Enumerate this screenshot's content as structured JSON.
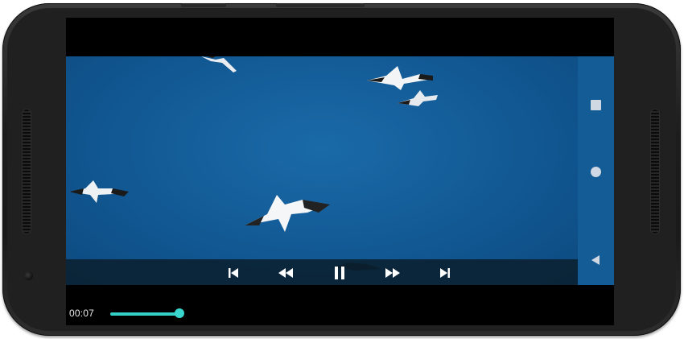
{
  "player": {
    "current_time": "00:07",
    "progress_percent": 21
  },
  "controls": {
    "skip_previous_icon": "skip-previous-icon",
    "rewind_icon": "rewind-icon",
    "pause_icon": "pause-icon",
    "fast_forward_icon": "fast-forward-icon",
    "skip_next_icon": "skip-next-icon"
  },
  "navigation_bar": {
    "recents_icon": "square-icon",
    "home_icon": "circle-icon",
    "back_icon": "back-triangle-icon"
  },
  "colors": {
    "accent": "#34cfc6",
    "video_sky": "#135c98",
    "bezel": "#1c1c1c"
  }
}
